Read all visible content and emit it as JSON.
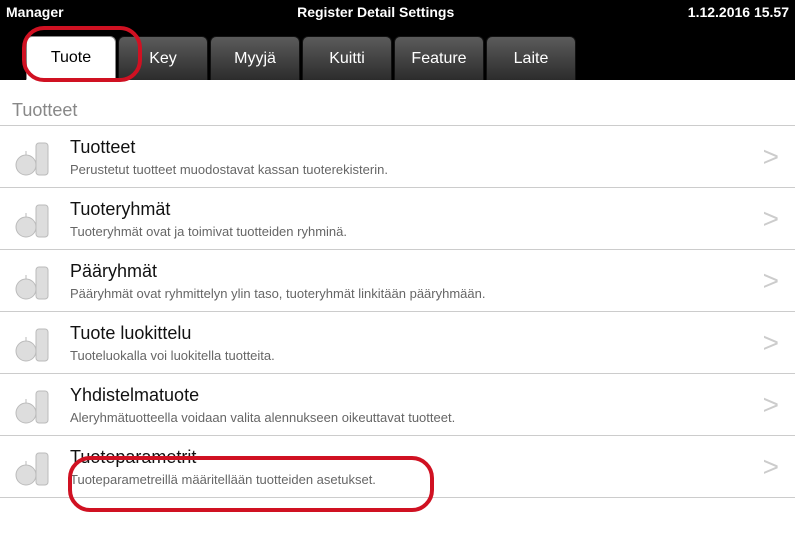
{
  "status": {
    "manager": "Manager",
    "title": "Register Detail Settings",
    "time": "1.12.2016 15.57"
  },
  "tabs": {
    "t0": "Tuote",
    "t1": "Key",
    "t2": "Myyjä",
    "t3": "Kuitti",
    "t4": "Feature",
    "t5": "Laite"
  },
  "section_header": "Tuotteet",
  "items": {
    "i0": {
      "title": "Tuotteet",
      "sub": "Perustetut tuotteet muodostavat kassan tuoterekisterin."
    },
    "i1": {
      "title": "Tuoteryhmät",
      "sub": "Tuoteryhmät ovat ja toimivat tuotteiden ryhminä."
    },
    "i2": {
      "title": "Pääryhmät",
      "sub": "Pääryhmät ovat ryhmittelyn ylin taso, tuoteryhmät linkitään pääryhmään."
    },
    "i3": {
      "title": "Tuote luokittelu",
      "sub": "Tuoteluokalla voi luokitella tuotteita."
    },
    "i4": {
      "title": "Yhdistelmatuote",
      "sub": "Aleryhmätuotteella voidaan valita alennukseen oikeuttavat tuotteet."
    },
    "i5": {
      "title": "Tuoteparametrit",
      "sub": "Tuoteparametreillä määritellään tuotteiden asetukset."
    }
  },
  "chevron": ">"
}
